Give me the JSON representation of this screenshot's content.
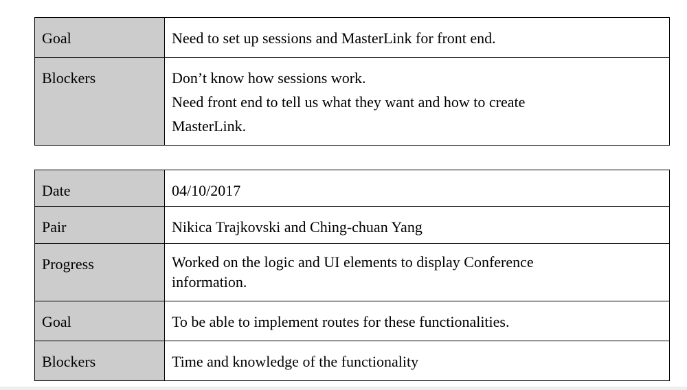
{
  "table1": {
    "rows": [
      {
        "label": "Goal",
        "lines": [
          "Need to set up sessions and MasterLink for front end."
        ]
      },
      {
        "label": "Blockers",
        "lines": [
          "Don’t know how sessions work.",
          "Need front end to tell us what they want and how to create MasterLink."
        ]
      }
    ]
  },
  "table2": {
    "rows": [
      {
        "label": "Date",
        "lines": [
          "04/10/2017"
        ]
      },
      {
        "label": "Pair",
        "lines": [
          "Nikica Trajkovski and Ching-chuan Yang"
        ]
      },
      {
        "label": "Progress",
        "lines": [
          "Worked on the logic and UI elements to display Conference information."
        ]
      },
      {
        "label": "Goal",
        "lines": [
          "To be able to implement routes for these functionalities."
        ]
      },
      {
        "label": "Blockers",
        "lines": [
          "Time and knowledge of the functionality"
        ]
      }
    ]
  }
}
